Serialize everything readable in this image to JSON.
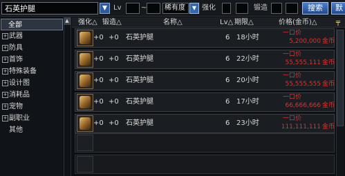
{
  "search": {
    "value": "石英护腿"
  },
  "filters": {
    "lv_label": "Lv",
    "lv_sep": "~",
    "rarity_value": "稀有度",
    "enhance_label": "强化",
    "forge_label": "锻造",
    "search_button": "搜索",
    "extra_button": "默"
  },
  "sidebar": {
    "items": [
      {
        "label": "全部",
        "expandable": false
      },
      {
        "label": "武器",
        "expandable": true
      },
      {
        "label": "防具",
        "expandable": true
      },
      {
        "label": "首饰",
        "expandable": true
      },
      {
        "label": "特殊装备",
        "expandable": true
      },
      {
        "label": "设计图",
        "expandable": true
      },
      {
        "label": "消耗品",
        "expandable": true
      },
      {
        "label": "宠物",
        "expandable": true
      },
      {
        "label": "副职业",
        "expandable": true
      },
      {
        "label": "其他",
        "expandable": false
      }
    ]
  },
  "table": {
    "headers": {
      "enhance": "强化△",
      "forge": "锻造△",
      "name": "名称△",
      "lv": "Lv△",
      "period": "期限△",
      "price": "价格(金币)△"
    },
    "rows": [
      {
        "enhance": "+0",
        "forge": "+0",
        "name": "石英护腿",
        "lv": "6",
        "time": "18小时",
        "price_label": "一口价",
        "price": "5,200,000",
        "currency": "金币"
      },
      {
        "enhance": "+0",
        "forge": "+0",
        "name": "石英护腿",
        "lv": "6",
        "time": "22小时",
        "price_label": "一口价",
        "price": "55,555,111",
        "currency": "金币"
      },
      {
        "enhance": "+0",
        "forge": "+0",
        "name": "石英护腿",
        "lv": "6",
        "time": "20小时",
        "price_label": "一口价",
        "price": "55,555,555",
        "currency": "金币"
      },
      {
        "enhance": "+0",
        "forge": "+0",
        "name": "石英护腿",
        "lv": "6",
        "time": "17小时",
        "price_label": "一口价",
        "price": "66,666,666",
        "currency": "金币"
      },
      {
        "enhance": "+0",
        "forge": "+0",
        "name": "石英护腿",
        "lv": "6",
        "time": "23小时",
        "price_label": "一口价",
        "price": "111,111,111",
        "currency": "金币"
      }
    ]
  },
  "colors": {
    "price": "#e3322a",
    "accent": "#3566b0"
  }
}
